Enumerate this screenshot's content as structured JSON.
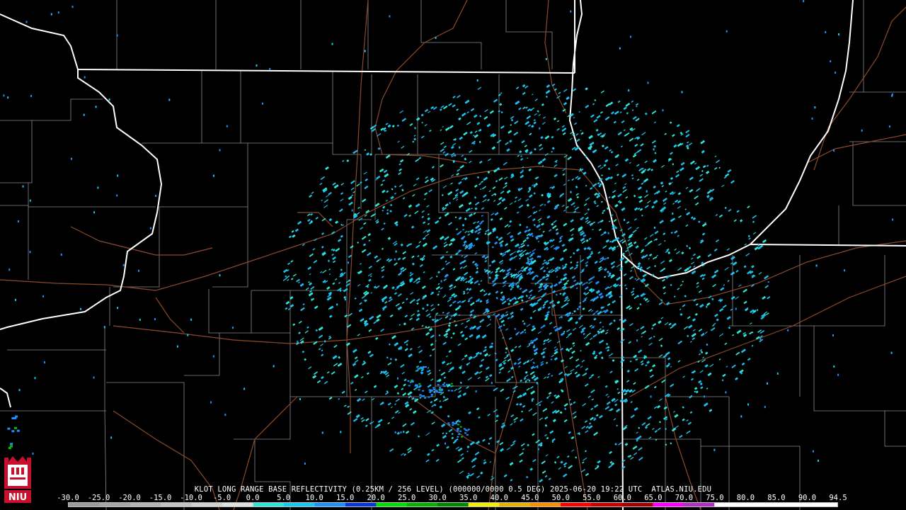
{
  "product": {
    "caption": "KLOT LONG RANGE BASE REFLECTIVITY (0.25KM / 256 LEVEL) (000000/0000 0.5 DEG) 2025-06-20 19:22 UTC  ATLAS.NIU.EDU"
  },
  "colorbar": {
    "ticks": [
      "-30.0",
      "-25.0",
      "-20.0",
      "-15.0",
      "-10.0",
      "-5.0",
      "0.0",
      "5.0",
      "10.0",
      "15.0",
      "20.0",
      "25.0",
      "30.0",
      "35.0",
      "40.0",
      "45.0",
      "50.0",
      "55.0",
      "60.0",
      "65.0",
      "70.0",
      "75.0",
      "80.0",
      "85.0",
      "90.0",
      "94.5"
    ],
    "colors": [
      "#9c9c9c",
      "#a6a6a6",
      "#b4b4b4",
      "#c4c4c4",
      "#d2d2d2",
      "#e0e0e0",
      "#2ee6d8",
      "#18c8f0",
      "#1e90ff",
      "#0a36d8",
      "#00e000",
      "#00b400",
      "#008800",
      "#f0f000",
      "#e6b400",
      "#ff8c00",
      "#ff0000",
      "#c80000",
      "#a00000",
      "#ff00ff",
      "#b030c0",
      "#ffffff",
      "#ffffff",
      "#ffffff",
      "#ffffff"
    ]
  },
  "logo": {
    "text": "NIU",
    "accent": "#c8102e"
  },
  "map_colors": {
    "state_borders": "#ffffff",
    "county_borders": "#8a8a8a",
    "highways": "#8b4a2b",
    "background": "#000000"
  },
  "radar": {
    "site": "KLOT"
  }
}
